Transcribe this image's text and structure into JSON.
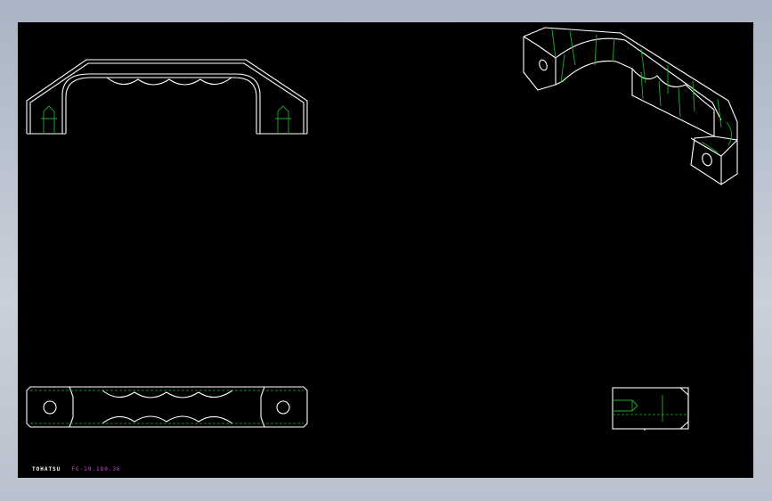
{
  "title_block": {
    "brand": "TOHATSU",
    "part_number": "FG-19.180.36"
  },
  "colors": {
    "sheet_background": "#000000",
    "outline": "#ffffff",
    "hidden_line": "#1fae2e",
    "part_number_text": "#e93ce8"
  }
}
